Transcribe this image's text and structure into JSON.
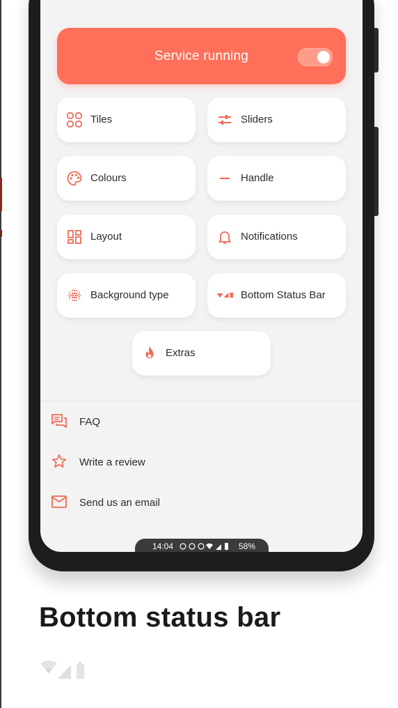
{
  "colors": {
    "accent": "#ff6f59",
    "accent_icon": "#ee6a55",
    "screen_bg": "#f3f3f3",
    "tile_bg": "#ffffff"
  },
  "service": {
    "label": "Service running",
    "toggle_on": true
  },
  "tiles": [
    {
      "label": "Tiles",
      "icon": "tiles-icon"
    },
    {
      "label": "Sliders",
      "icon": "sliders-icon"
    },
    {
      "label": "Colours",
      "icon": "palette-icon"
    },
    {
      "label": "Handle",
      "icon": "handle-icon"
    },
    {
      "label": "Layout",
      "icon": "layout-icon"
    },
    {
      "label": "Notifications",
      "icon": "bell-icon"
    },
    {
      "label": "Background type",
      "icon": "dotted-grid-icon"
    },
    {
      "label": "Bottom Status Bar",
      "icon": "status-bar-icon"
    },
    {
      "label": "Extras",
      "icon": "flame-icon"
    }
  ],
  "links": [
    {
      "label": "FAQ",
      "icon": "chat-icon"
    },
    {
      "label": "Write a review",
      "icon": "star-icon"
    },
    {
      "label": "Send us an email",
      "icon": "mail-icon"
    }
  ],
  "status_bar": {
    "time": "14:04",
    "battery": "58%"
  },
  "caption": {
    "title": "Bottom status bar"
  }
}
